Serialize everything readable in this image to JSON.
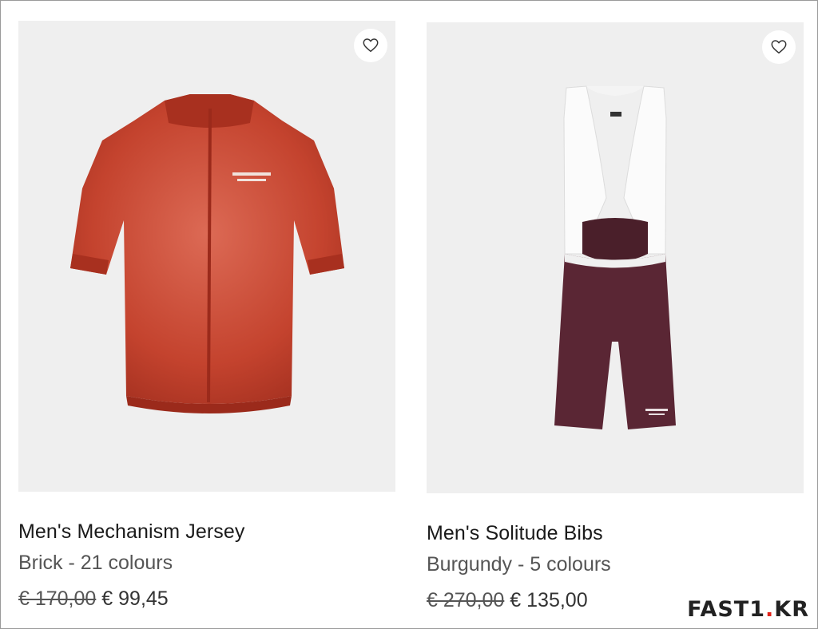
{
  "products": [
    {
      "name": "Men's Mechanism Jersey",
      "variant": "Brick - 21 colours",
      "old_price": "€ 170,00",
      "price": "€ 99,45",
      "wishlist_icon": "heart-outline-icon",
      "color": "#c4432e"
    },
    {
      "name": "Men's Solitude Bibs",
      "variant": "Burgundy - 5 colours",
      "old_price": "€ 270,00",
      "price": "€ 135,00",
      "wishlist_icon": "heart-outline-icon",
      "color": "#5a2634"
    }
  ],
  "watermark": {
    "prefix": "FAST1",
    "dot": ".",
    "suffix": "KR"
  }
}
